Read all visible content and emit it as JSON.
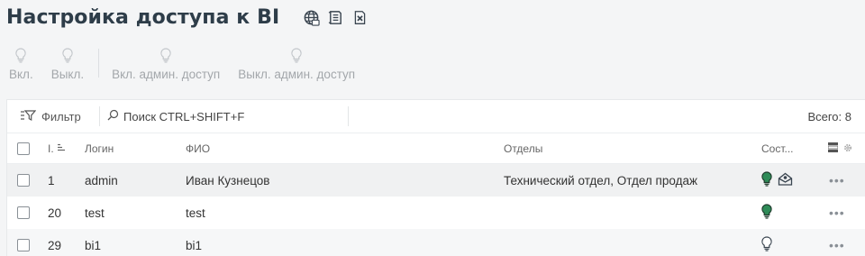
{
  "page": {
    "title": "Настройка доступа к BI",
    "icons": [
      "globe-icon",
      "document-list-icon",
      "excel-export-icon"
    ]
  },
  "toolbar": {
    "buttons": [
      {
        "label": "Вкл.",
        "icon": "bulb-icon"
      },
      {
        "label": "Выкл.",
        "icon": "bulb-icon"
      },
      {
        "label": "Вкл. админ. доступ",
        "icon": "bulb-icon"
      },
      {
        "label": "Выкл. админ. доступ",
        "icon": "bulb-icon"
      }
    ]
  },
  "grid": {
    "filter_label": "Фильтр",
    "search_placeholder": "Поиск CTRL+SHIFT+F",
    "total_label": "Всего: 8",
    "columns": {
      "id": "I.",
      "login": "Логин",
      "fio": "ФИО",
      "departments": "Отделы",
      "state": "Сост..."
    },
    "rows": [
      {
        "id": "1",
        "login": "admin",
        "fio": "Иван Кузнецов",
        "departments": "Технический отдел, Отдел продаж",
        "active": true,
        "admin": true
      },
      {
        "id": "20",
        "login": "test",
        "fio": "test",
        "departments": "",
        "active": true,
        "admin": false
      },
      {
        "id": "29",
        "login": "bi1",
        "fio": "bi1",
        "departments": "",
        "active": false,
        "admin": false
      }
    ]
  },
  "colors": {
    "active_bulb": "#2e8b57",
    "inactive_bulb": "#5a6168",
    "disabled_text": "#a3a7ab",
    "title": "#2e3d49"
  }
}
